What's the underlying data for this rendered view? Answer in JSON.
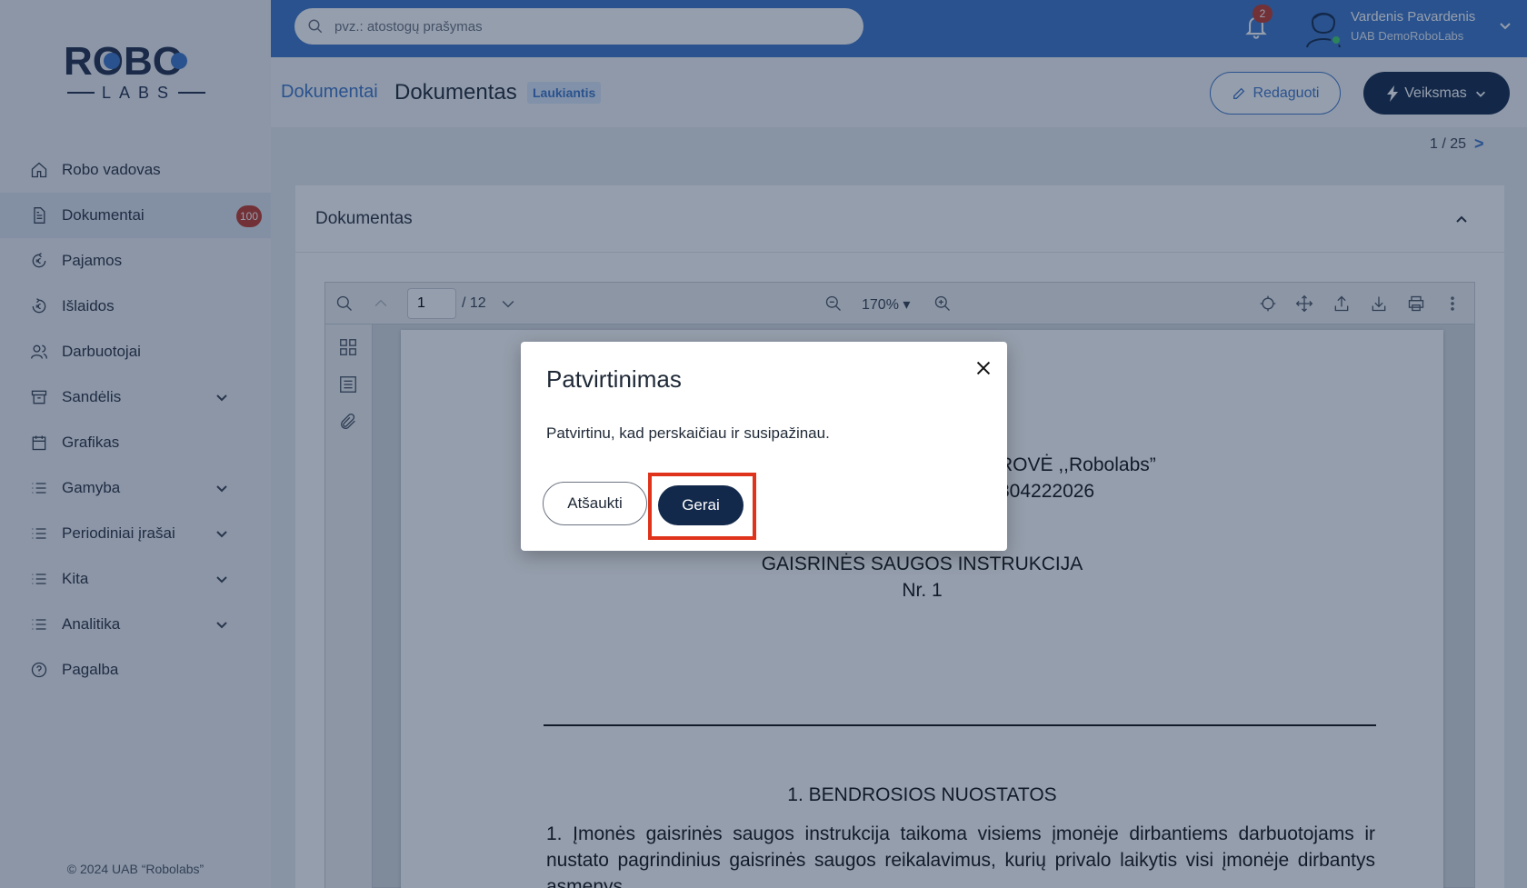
{
  "app": {
    "logo_top": "ROBO",
    "logo_bottom": "LABS",
    "copyright": "© 2024 UAB “Robolabs”"
  },
  "sidebar": {
    "items": [
      {
        "label": "Robo vadovas",
        "icon": "home-icon"
      },
      {
        "label": "Dokumentai",
        "icon": "document-icon",
        "badge": "100",
        "active": true
      },
      {
        "label": "Pajamos",
        "icon": "income-icon"
      },
      {
        "label": "Išlaidos",
        "icon": "expenses-icon"
      },
      {
        "label": "Darbuotojai",
        "icon": "users-icon"
      },
      {
        "label": "Sandėlis",
        "icon": "archive-icon",
        "expandable": true
      },
      {
        "label": "Grafikas",
        "icon": "calendar-icon"
      },
      {
        "label": "Gamyba",
        "icon": "list-icon",
        "expandable": true
      },
      {
        "label": "Periodiniai įrašai",
        "icon": "list-icon",
        "expandable": true
      },
      {
        "label": "Kita",
        "icon": "list-icon",
        "expandable": true
      },
      {
        "label": "Analitika",
        "icon": "list-icon",
        "expandable": true
      },
      {
        "label": "Pagalba",
        "icon": "help-icon"
      }
    ]
  },
  "topbar": {
    "search_placeholder": "pvz.: atostogų prašymas",
    "notifications_count": "2",
    "user_name": "Vardenis Pavardenis",
    "user_company": "UAB DemoRoboLabs"
  },
  "header": {
    "breadcrumb": "Dokumentai",
    "title": "Dokumentas",
    "status": "Laukiantis",
    "edit_label": "Redaguoti",
    "action_label": "Veiksmas"
  },
  "pager": {
    "text": "1 / 25",
    "next": ">"
  },
  "panel": {
    "title": "Dokumentas"
  },
  "viewer": {
    "page_current": "1",
    "page_total": "/ 12",
    "zoom": "170%"
  },
  "document": {
    "line1": "ROVĖ ,,Robolabs”",
    "line2": "304222026",
    "heading1": "GAISRINĖS SAUGOS INSTRUKCIJA",
    "heading2": "Nr. 1",
    "section": "1.  BENDROSIOS NUOSTATOS",
    "paragraph": "1. Įmonės gaisrinės saugos instrukcija taikoma visiems įmonėje dirbantiems darbuotojams ir nustato pagrindinius gaisrinės saugos reikalavimus, kurių privalo laikytis visi įmonėje dirbantys asmenys."
  },
  "modal": {
    "title": "Patvirtinimas",
    "text": "Patvirtinu, kad perskaičiau ir susipažinau.",
    "cancel_label": "Atšaukti",
    "ok_label": "Gerai"
  },
  "colors": {
    "accent": "#3d76c9",
    "navy": "#13294b",
    "danger": "#c0392b",
    "highlight": "#e0331b"
  }
}
